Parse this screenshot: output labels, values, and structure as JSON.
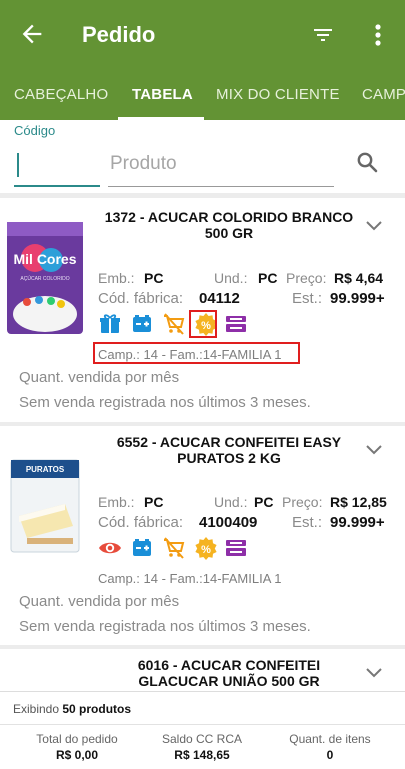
{
  "appbar": {
    "title": "Pedido",
    "back_icon": "arrow-back-icon",
    "filter_icon": "filter-icon",
    "more_icon": "more-vert-icon"
  },
  "tabs": [
    {
      "label": "CABEÇALHO",
      "active": false
    },
    {
      "label": "TABELA",
      "active": true
    },
    {
      "label": "MIX DO CLIENTE",
      "active": false
    },
    {
      "label": "CAMP",
      "active": false
    }
  ],
  "search": {
    "code_label": "Código",
    "code_value": "",
    "product_placeholder": "Produto",
    "search_icon": "search-icon"
  },
  "products": [
    {
      "code_name": "1372 - ACUCAR COLORIDO BRANCO 500 GR",
      "emb_label": "Emb.:",
      "emb": "PC",
      "und_label": "Und.:",
      "und": "PC",
      "preco_label": "Preço:",
      "preco": "R$ 4,64",
      "cod_fab_label": "Cód. fábrica:",
      "cod_fab": "04112",
      "est_label": "Est.:",
      "est": "99.999+",
      "icons": [
        "gift-icon",
        "battery-icon",
        "cart-off-icon",
        "percent-badge-icon",
        "kit-icon"
      ],
      "camp": "Camp.: 14 - Fam.:14-FAMILIA 1",
      "quant_label": "Quant. vendida por mês",
      "sem_venda": "Sem venda registrada nos últimos 3 meses.",
      "image_brand": "Mil Cores",
      "image_caption": "AÇÚCAR COLORIDO"
    },
    {
      "code_name": "6552 - ACUCAR CONFEITEI EASY PURATOS 2 KG",
      "emb_label": "Emb.:",
      "emb": "PC",
      "und_label": "Und.:",
      "und": "PC",
      "preco_label": "Preço:",
      "preco": "R$ 12,85",
      "cod_fab_label": "Cód. fábrica:",
      "cod_fab": "4100409",
      "est_label": "Est.:",
      "est": "99.999+",
      "icons": [
        "eye-icon",
        "battery-icon",
        "cart-off-icon",
        "percent-badge-icon",
        "kit-icon"
      ],
      "camp": "Camp.: 14 - Fam.:14-FAMILIA 1",
      "quant_label": "Quant. vendida por mês",
      "sem_venda": "Sem venda registrada nos últimos 3 meses.",
      "image_brand": "PURATOS"
    },
    {
      "code_name": "6016 - ACUCAR CONFEITEI GLACUCAR UNIÃO 500 GR"
    }
  ],
  "footer": {
    "showing_prefix": "Exibindo",
    "showing_count": "50 produtos",
    "total_label": "Total do pedido",
    "total_value": "R$ 0,00",
    "saldo_label": "Saldo CC RCA",
    "saldo_value": "R$ 148,65",
    "quant_label": "Quant. de itens",
    "quant_value": "0"
  },
  "colors": {
    "primary": "#639334",
    "teal": "#2b8a8a",
    "icon_blue": "#1a8fd8",
    "icon_orange": "#f39c12",
    "icon_purple": "#8e2fa8",
    "icon_red": "#e74c3c",
    "highlight": "#e01e1e"
  }
}
